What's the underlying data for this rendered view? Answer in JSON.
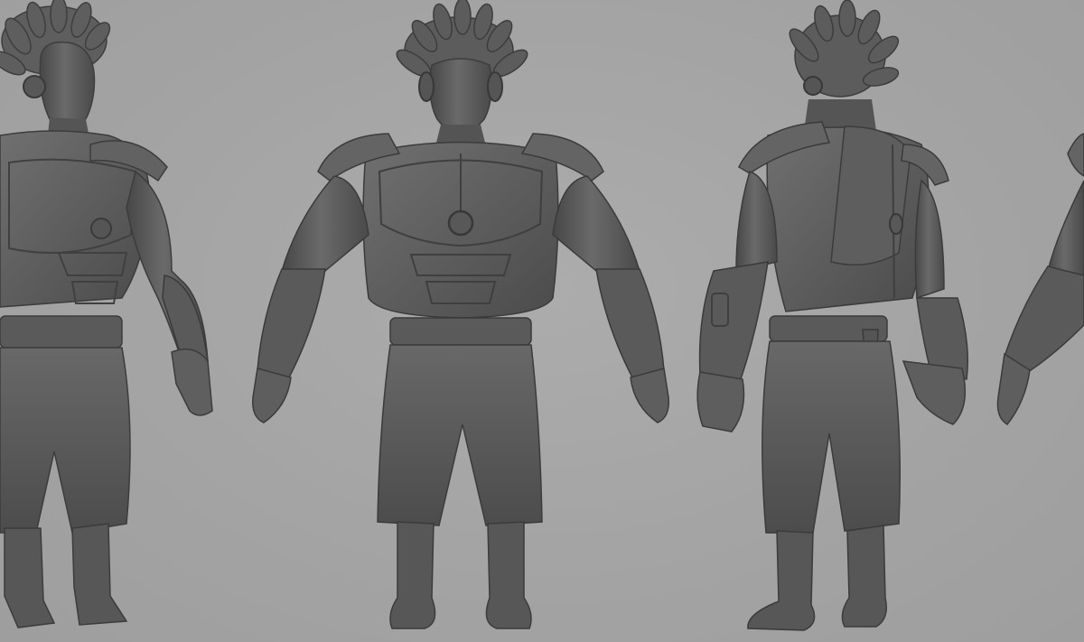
{
  "scene": {
    "background_color": "#a5a5a5",
    "model_color": "#5b5b5b",
    "model_highlight": "#707070",
    "model_shadow": "#3c3c3c",
    "views": [
      {
        "id": "three-quarter-front",
        "icon": "sculpt-figure"
      },
      {
        "id": "front",
        "icon": "sculpt-figure"
      },
      {
        "id": "three-quarter-back",
        "icon": "sculpt-figure"
      },
      {
        "id": "side-partial",
        "icon": "sculpt-figure"
      }
    ]
  }
}
